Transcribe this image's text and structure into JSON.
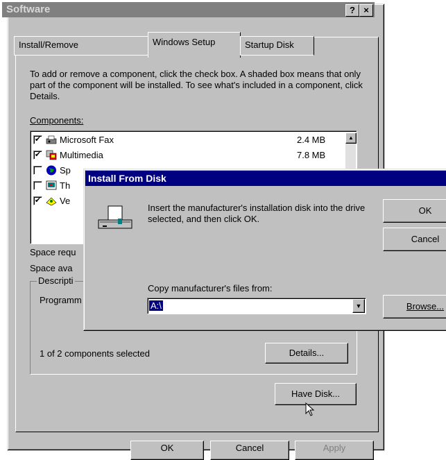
{
  "window": {
    "title": "Software",
    "help_btn": "?",
    "close_btn": "×"
  },
  "tabs": [
    {
      "label": "Install/Remove"
    },
    {
      "label": "Windows Setup"
    },
    {
      "label": "Startup Disk"
    }
  ],
  "setup": {
    "intro": "To add or remove a component, click the check box. A shaded box means that only part of the component will be installed. To see what's included in a component, click Details.",
    "components_label": "Components:",
    "components": [
      {
        "name": "Microsoft Fax",
        "size": "2.4 MB",
        "checked": true,
        "icon": "fax-icon"
      },
      {
        "name": "Multimedia",
        "size": "7.8 MB",
        "checked": true,
        "icon": "multimedia-icon"
      },
      {
        "name": "Sp",
        "size": "",
        "checked": false,
        "icon": "globe-icon"
      },
      {
        "name": "Th",
        "size": "",
        "checked": false,
        "icon": "desktop-themes-icon"
      },
      {
        "name": "Ve",
        "size": "",
        "checked": true,
        "icon": "accessories-icon"
      }
    ],
    "space_required": "Space requ",
    "space_available": "Space ava",
    "description_label": "Descripti",
    "description_text": "Programm",
    "selected_count": "1 of 2 components selected",
    "details_btn": "Details...",
    "have_disk_btn": "Have Disk..."
  },
  "footer": {
    "ok_btn": "OK",
    "cancel_btn": "Cancel",
    "apply_btn": "Apply"
  },
  "dialog": {
    "title": "Install From Disk",
    "message": "Insert the manufacturer's installation disk into the drive selected, and then click OK.",
    "copy_label": "Copy manufacturer's files from:",
    "copy_value": "A:\\",
    "ok_btn": "OK",
    "cancel_btn": "Cancel",
    "browse_btn": "Browse..."
  }
}
